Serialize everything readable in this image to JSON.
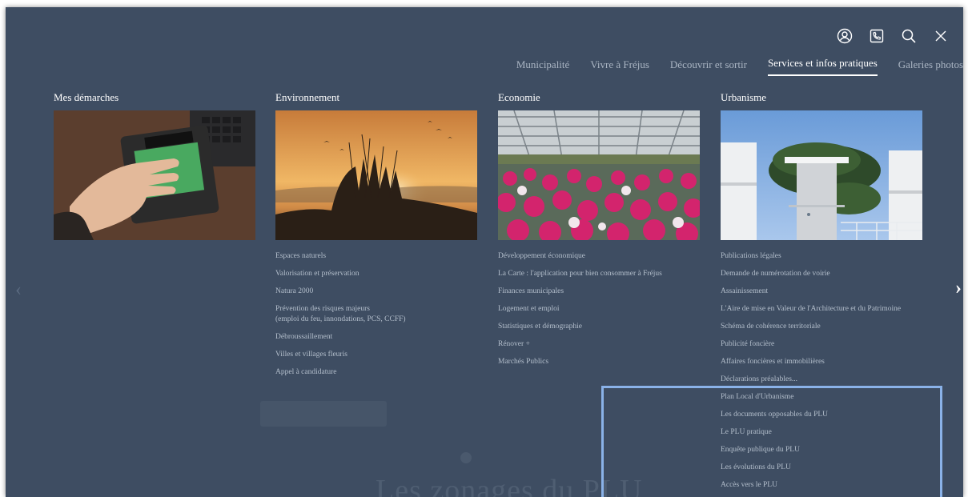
{
  "header": {
    "icons": [
      "user-icon",
      "contact-icon",
      "search-icon",
      "close-icon"
    ]
  },
  "nav": {
    "items": [
      {
        "label": "Municipalité"
      },
      {
        "label": "Vivre à Fréjus"
      },
      {
        "label": "Découvrir et sortir"
      },
      {
        "label": "Services et infos pratiques"
      },
      {
        "label": "Galeries photos"
      }
    ],
    "active": "Services et infos pratiques"
  },
  "columns": [
    {
      "title": "Mes démarches",
      "image": "fingerprint-scanner-photo",
      "links": []
    },
    {
      "title": "Environnement",
      "image": "sunset-reeds-photo",
      "links": [
        "Espaces naturels",
        "Valorisation et préservation",
        "Natura 2000",
        "Prévention des risques majeurs",
        "(emploi du feu, innondations, PCS, CCFF)",
        "Débroussaillement",
        "Villes et villages fleuris",
        "Appel à candidature"
      ]
    },
    {
      "title": "Economie",
      "image": "greenhouse-flowers-photo",
      "links": [
        "Développement économique",
        "La Carte : l'application pour bien consommer à Fréjus",
        "Finances municipales",
        "Logement et emploi",
        "Statistiques et démographie",
        "Rénover +",
        "Marchés Publics"
      ]
    },
    {
      "title": "Urbanisme",
      "image": "modern-building-photo",
      "links": [
        "Publications légales",
        "Demande de numérotation de voirie",
        "Assainissement",
        "L'Aire de mise en Valeur de l'Architecture et du Patrimoine",
        "Schéma de cohérence territoriale",
        "Publicité foncière",
        "Affaires foncières et immobilières",
        "Déclarations préalables...",
        "Plan Local d'Urbanisme",
        "Les documents opposables du PLU",
        "Le PLU pratique",
        "Enquête publique du PLU",
        "Les évolutions du PLU",
        "Accès vers le PLU"
      ]
    }
  ],
  "background": {
    "title": "Les zonages du PLU"
  },
  "colors": {
    "overlay": "#3e4d62",
    "link": "#b4bfcc",
    "highlight": "#8ab2e8"
  }
}
